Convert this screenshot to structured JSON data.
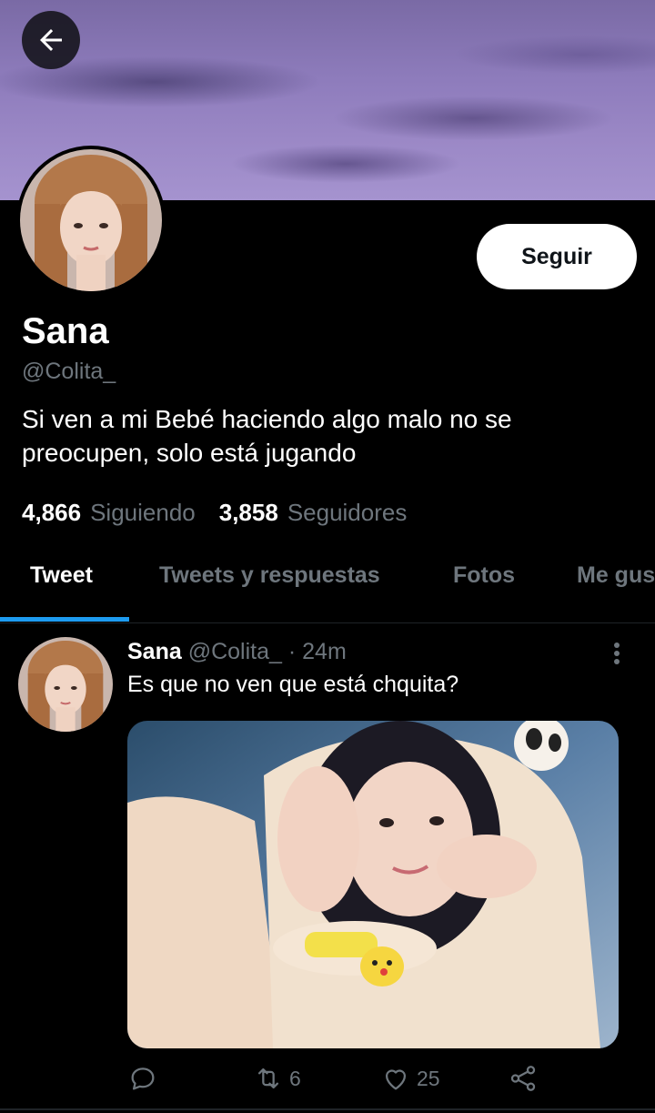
{
  "profile": {
    "name": "Sana",
    "handle": "@Colita_",
    "bio": "Si ven a mi Bebé haciendo algo malo no se preocupen, solo está jugando",
    "following_count": "4,866",
    "following_label": "Siguiendo",
    "followers_count": "3,858",
    "followers_label": "Seguidores",
    "follow_button": "Seguir"
  },
  "tabs": [
    {
      "label": "Tweet",
      "active": true
    },
    {
      "label": "Tweets y respuestas",
      "active": false
    },
    {
      "label": "Fotos",
      "active": false
    },
    {
      "label": "Me gus",
      "active": false
    }
  ],
  "tweet": {
    "name": "Sana",
    "handle": "@Colita_",
    "separator": "·",
    "time": "24m",
    "text": "Es que no ven que está chquita?",
    "retweets": "6",
    "likes": "25"
  },
  "icons": {
    "back": "arrow-left-icon",
    "more": "more-vertical-icon",
    "reply": "reply-icon",
    "retweet": "retweet-icon",
    "like": "heart-icon",
    "share": "share-icon"
  },
  "colors": {
    "accent": "#1d9bf0",
    "secondary_text": "#6e767d",
    "background": "#000000"
  }
}
